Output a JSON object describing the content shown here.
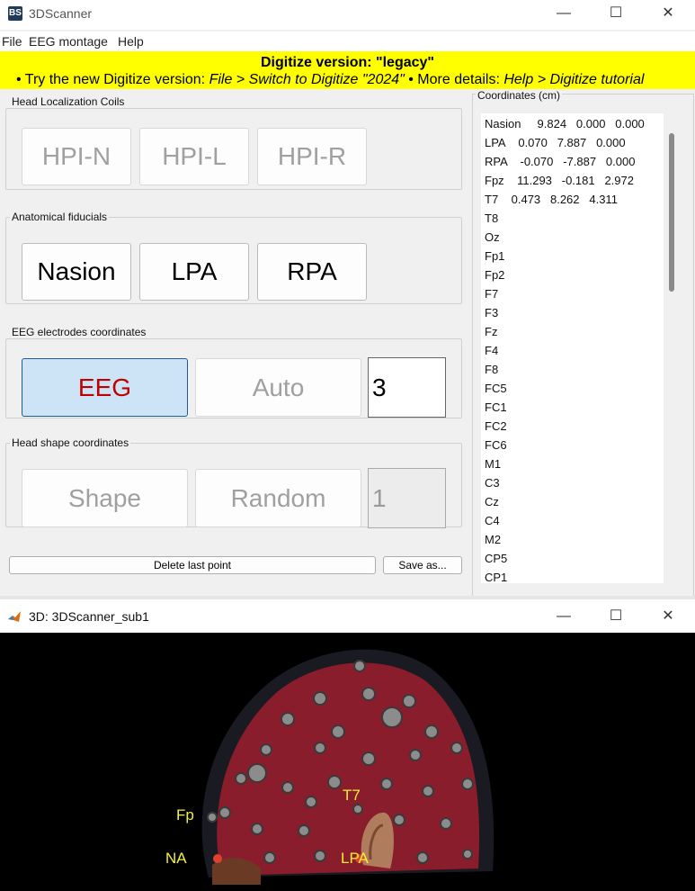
{
  "window": {
    "app_icon": "BS",
    "title": "3DScanner"
  },
  "menu": [
    "File",
    "EEG montage",
    "Help"
  ],
  "banner": {
    "line1": "Digitize version: \"legacy\"",
    "line2_prefix": "• Try the new Digitize version: ",
    "line2_path": "File > Switch to Digitize \"2024\"",
    "line2_mid": "  • More details: ",
    "line2_help": "Help > Digitize tutorial"
  },
  "groups": {
    "hpi": {
      "title": "Head Localization Coils",
      "buttons": [
        "HPI-N",
        "HPI-L",
        "HPI-R"
      ]
    },
    "fiducials": {
      "title": "Anatomical fiducials",
      "buttons": [
        "Nasion",
        "LPA",
        "RPA"
      ]
    },
    "eeg": {
      "title": "EEG electrodes coordinates",
      "eeg_label": "EEG",
      "auto_label": "Auto",
      "count": "3"
    },
    "shape": {
      "title": "Head shape coordinates",
      "shape_label": "Shape",
      "random_label": "Random",
      "count": "1"
    }
  },
  "actions": {
    "delete_label": "Delete last point",
    "save_label": "Save as..."
  },
  "coordinates": {
    "title": "Coordinates (cm)",
    "rows": [
      "Nasion     9.824   0.000   0.000",
      "LPA    0.070   7.887   0.000",
      "RPA    -0.070   -7.887   0.000",
      "Fpz    11.293   -0.181   2.972",
      "T7    0.473   8.262   4.311",
      "T8",
      "Oz",
      "Fp1",
      "Fp2",
      "F7",
      "F3",
      "Fz",
      "F4",
      "F8",
      "FC5",
      "FC1",
      "FC2",
      "FC6",
      "M1",
      "C3",
      "Cz",
      "C4",
      "M2",
      "CP5",
      "CP1"
    ]
  },
  "figure": {
    "title": "3D: 3DScanner_sub1",
    "labels": {
      "fp": "Fp",
      "na": "NA",
      "t7": "T7",
      "lpa": "LPA"
    },
    "colors": {
      "cap": "#8a1d2c",
      "rim": "#1a1a22",
      "label": "#f5f032"
    }
  },
  "icons": {
    "minimize": "minimize-icon",
    "maximize": "maximize-icon",
    "close": "close-icon",
    "matlab": "matlab-icon"
  }
}
